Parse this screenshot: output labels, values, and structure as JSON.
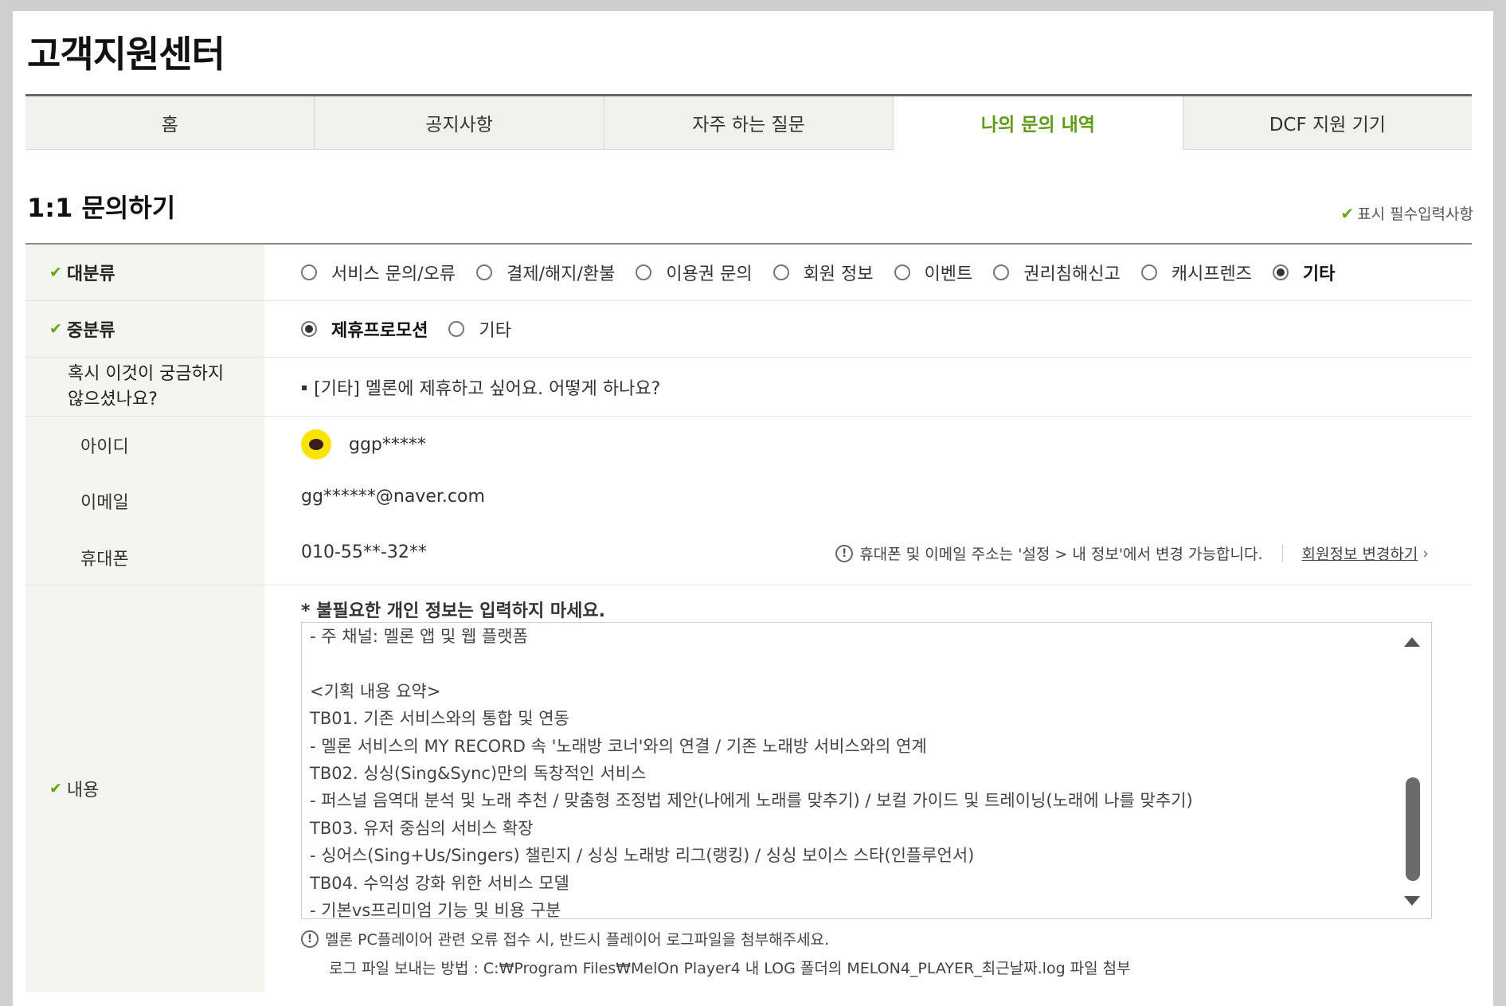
{
  "header": {
    "title": "고객지원센터"
  },
  "tabs": [
    {
      "label": "홈"
    },
    {
      "label": "공지사항"
    },
    {
      "label": "자주 하는 질문"
    },
    {
      "label": "나의 문의 내역"
    },
    {
      "label": "DCF 지원 기기"
    }
  ],
  "section": {
    "title": "1:1 문의하기",
    "required_note": "표시 필수입력사항"
  },
  "form": {
    "category": {
      "label": "대분류",
      "options": [
        "서비스 문의/오류",
        "결제/해지/환불",
        "이용권 문의",
        "회원 정보",
        "이벤트",
        "권리침해신고",
        "캐시프렌즈",
        "기타"
      ],
      "selected": "기타"
    },
    "subcategory": {
      "label": "중분류",
      "options": [
        "제휴프로모션",
        "기타"
      ],
      "selected": "제휴프로모션"
    },
    "faq": {
      "label_line1": "혹시 이것이 궁금하지",
      "label_line2": "않으셨나요?",
      "link": "[기타] 멜론에 제휴하고 싶어요. 어떻게 하나요?"
    },
    "id": {
      "label": "아이디",
      "value": "ggp*****"
    },
    "email": {
      "label": "이메일",
      "value": "gg******@naver.com"
    },
    "phone": {
      "label": "휴대폰",
      "value": "010-55**-32**",
      "notice": "휴대폰 및 이메일 주소는 '설정 > 내 정보'에서 변경 가능합니다.",
      "link": "회원정보 변경하기"
    },
    "content": {
      "label": "내용",
      "warning": "* 불필요한 개인 정보는 입력하지 마세요.",
      "lines": [
        "- 주 채널: 멜론 앱 및 웹 플랫폼",
        "",
        "<기획 내용 요약>",
        "TB01. 기존 서비스와의 통합 및 연동",
        "- 멜론 서비스의 MY RECORD 속 '노래방 코너'와의 연결 / 기존 노래방 서비스와의 연계",
        "TB02. 싱싱(Sing&Sync)만의 독창적인 서비스",
        "- 퍼스널 음역대 분석 및 노래 추천 / 맞춤형 조정법 제안(나에게 노래를 맞추기) / 보컬 가이드 및 트레이닝(노래에 나를 맞추기)",
        "TB03. 유저 중심의 서비스 확장",
        "- 싱어스(Sing+Us/Singers) 챌린지 / 싱싱 노래방 리그(랭킹) / 싱싱 보이스 스타(인플루언서)",
        "TB04. 수익성 강화 위한 서비스 모델",
        "- 기본vs프리미엄 기능 및 비용 구분"
      ],
      "tip1": "멜론 PC플레이어 관련 오류 접수 시, 반드시 플레이어 로그파일을 첨부해주세요.",
      "tip2": "로그 파일 보내는 방법 : C:₩Program Files₩MelOn Player4 내 LOG 폴더의 MELON4_PLAYER_최근날짜.log 파일 첨부"
    }
  },
  "colors": {
    "accent": "#5f9a18",
    "label_bg": "#f3f6ee",
    "tab_bg": "#eef1ec",
    "kakao": "#fbe300"
  }
}
